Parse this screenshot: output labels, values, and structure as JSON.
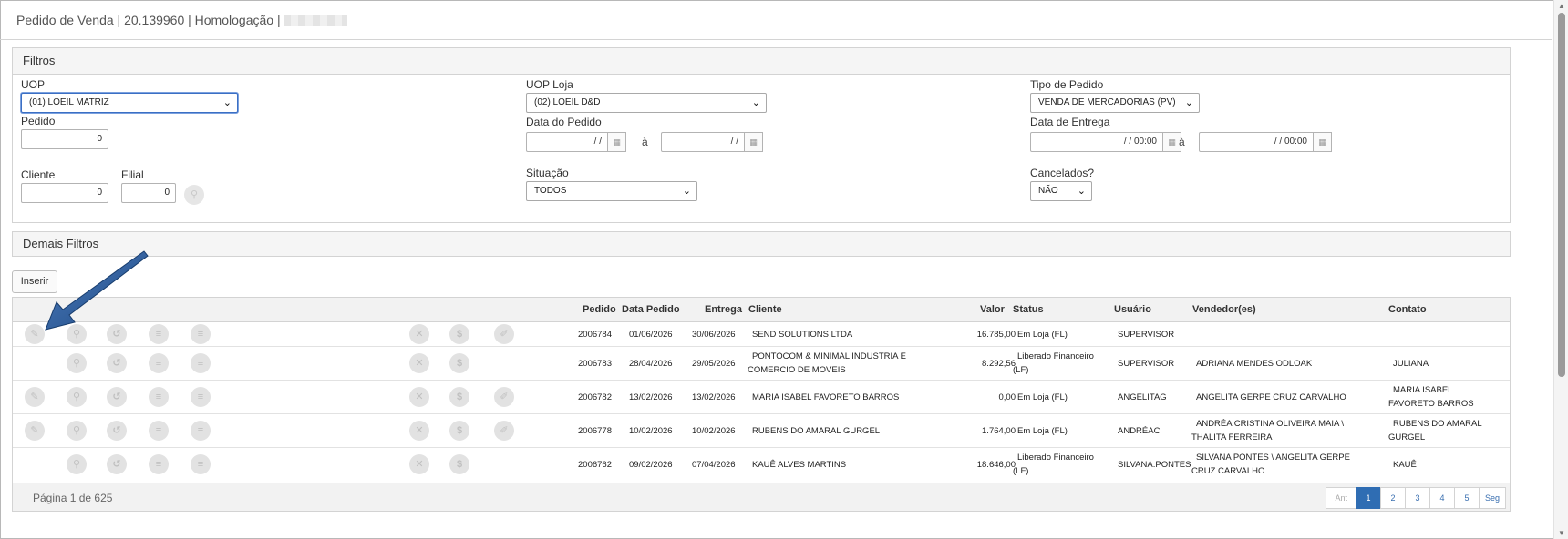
{
  "title": "Pedido de Venda | 20.139960 | Homologação |",
  "filtros": {
    "header": "Filtros",
    "uop": {
      "label": "UOP",
      "value": "(01) LOEIL MATRIZ"
    },
    "uop_loja": {
      "label": "UOP Loja",
      "value": "(02) LOEIL D&D"
    },
    "tipo_pedido": {
      "label": "Tipo de Pedido",
      "value": "VENDA DE MERCADORIAS (PV)"
    },
    "pedido": {
      "label": "Pedido",
      "value": "0"
    },
    "data_pedido": {
      "label": "Data do Pedido",
      "from": "/ /",
      "to": "/ /",
      "sep": "à"
    },
    "data_entrega": {
      "label": "Data de Entrega",
      "from": "/ /     00:00",
      "to": "/ /     00:00",
      "sep": "à"
    },
    "cliente": {
      "label": "Cliente",
      "value": "0"
    },
    "filial": {
      "label": "Filial",
      "value": "0"
    },
    "situacao": {
      "label": "Situação",
      "value": "TODOS"
    },
    "cancelados": {
      "label": "Cancelados?",
      "value": "NÃO"
    }
  },
  "demais_filtros": {
    "header": "Demais Filtros"
  },
  "inserir_label": "Inserir",
  "grid": {
    "columns": {
      "pedido": "Pedido",
      "data_pedido": "Data Pedido",
      "entrega": "Entrega",
      "cliente": "Cliente",
      "valor": "Valor",
      "status": "Status",
      "usuario": "Usuário",
      "vendedores": "Vendedor(es)",
      "contato": "Contato"
    },
    "rows": [
      {
        "pedido": "2006784",
        "data_pedido": "01/06/2026",
        "entrega": "30/06/2026",
        "cliente": "SEND SOLUTIONS LTDA",
        "valor": "16.785,00",
        "status": "Em Loja (FL)",
        "usuario": "SUPERVISOR",
        "vendedores": "",
        "contato": ""
      },
      {
        "pedido": "2006783",
        "data_pedido": "28/04/2026",
        "entrega": "29/05/2026",
        "cliente": "PONTOCOM & MINIMAL INDUSTRIA E COMERCIO DE MOVEIS",
        "valor": "8.292,56",
        "status": "Liberado Financeiro (LF)",
        "usuario": "SUPERVISOR",
        "vendedores": "ADRIANA MENDES ODLOAK",
        "contato": "JULIANA"
      },
      {
        "pedido": "2006782",
        "data_pedido": "13/02/2026",
        "entrega": "13/02/2026",
        "cliente": "MARIA ISABEL FAVORETO BARROS",
        "valor": "0,00",
        "status": "Em Loja (FL)",
        "usuario": "ANGELITAG",
        "vendedores": "ANGELITA GERPE CRUZ CARVALHO",
        "contato": "MARIA ISABEL FAVORETO BARROS"
      },
      {
        "pedido": "2006778",
        "data_pedido": "10/02/2026",
        "entrega": "10/02/2026",
        "cliente": "RUBENS DO AMARAL GURGEL",
        "valor": "1.764,00",
        "status": "Em Loja (FL)",
        "usuario": "ANDRÉAC",
        "vendedores": "ANDRÉA CRISTINA OLIVEIRA MAIA \\ THALITA FERREIRA",
        "contato": "RUBENS DO AMARAL GURGEL"
      },
      {
        "pedido": "2006762",
        "data_pedido": "09/02/2026",
        "entrega": "07/04/2026",
        "cliente": "KAUÊ ALVES MARTINS",
        "valor": "18.646,00",
        "status": "Liberado Financeiro (LF)",
        "usuario": "SILVANA.PONTES",
        "vendedores": "SILVANA PONTES \\ ANGELITA GERPE CRUZ CARVALHO",
        "contato": "KAUÊ"
      }
    ]
  },
  "footer": {
    "page_info": "Página 1 de 625",
    "pager": {
      "prev": "Ant",
      "pages": [
        "1",
        "2",
        "3",
        "4",
        "5"
      ],
      "next": "Seg",
      "current": "1"
    }
  },
  "colors": {
    "accent": "#2f6db3",
    "arrow": "#1f4e8c"
  }
}
